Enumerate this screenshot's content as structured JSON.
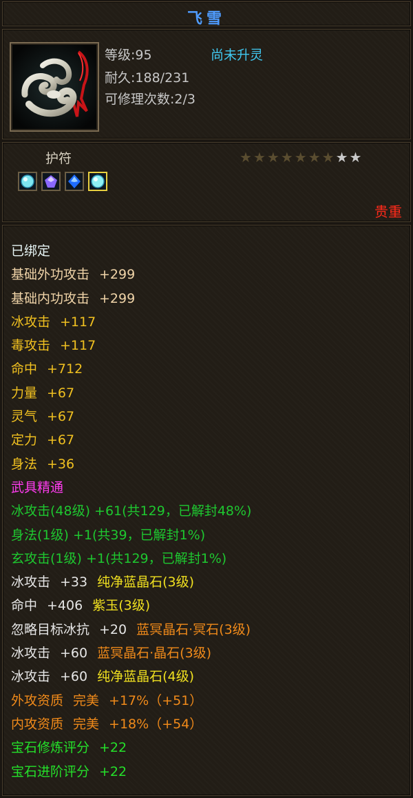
{
  "item": {
    "name": "飞雪",
    "level_text": "等级:95",
    "spirit_status": "尚未升灵",
    "durability_text": "耐久:188/231",
    "repair_text": "可修理次数:2/3",
    "type": "护符",
    "rarity": "贵重",
    "stars_total": 9,
    "stars_dim": 7,
    "gems": [
      "cyan-gem-icon",
      "purple-gem-icon",
      "blue-gem-icon",
      "cyan-gem-icon"
    ],
    "colors": {
      "title": "#4f9cff",
      "spirit": "#40c8f0",
      "rarity": "#ff2a1a"
    }
  },
  "stats": [
    {
      "a": "已绑定",
      "ca": "c-cyanw"
    },
    {
      "a": "基础外功攻击",
      "b": "+299",
      "ca": "c-peach",
      "cb": "c-peach"
    },
    {
      "a": "基础内功攻击",
      "b": "+299",
      "ca": "c-peach",
      "cb": "c-peach"
    },
    {
      "a": "冰攻击",
      "b": "+117",
      "ca": "c-yellow",
      "cb": "c-yellow"
    },
    {
      "a": "毒攻击",
      "b": "+117",
      "ca": "c-yellow",
      "cb": "c-yellow"
    },
    {
      "a": "命中",
      "b": "+712",
      "ca": "c-yellow",
      "cb": "c-yellow"
    },
    {
      "a": "力量",
      "b": "+67",
      "ca": "c-yellow",
      "cb": "c-yellow"
    },
    {
      "a": "灵气",
      "b": "+67",
      "ca": "c-yellow",
      "cb": "c-yellow"
    },
    {
      "a": "定力",
      "b": "+67",
      "ca": "c-yellow",
      "cb": "c-yellow"
    },
    {
      "a": "身法",
      "b": "+36",
      "ca": "c-yellow",
      "cb": "c-yellow"
    },
    {
      "a": "武具精通",
      "ca": "c-pink"
    },
    {
      "a": "冰攻击(48级) +61(共129，已解封48%)",
      "ca": "c-green"
    },
    {
      "a": "身法(1级) +1(共39，已解封1%)",
      "ca": "c-green"
    },
    {
      "a": "玄攻击(1级) +1(共129，已解封1%)",
      "ca": "c-green"
    },
    {
      "a": "冰攻击",
      "b": "+33",
      "c": "纯净蓝晶石(3级)",
      "ca": "c-white",
      "cb": "c-white",
      "cc": "c-gyellow"
    },
    {
      "a": "命中",
      "b": "+406",
      "c": "紫玉(3级)",
      "ca": "c-white",
      "cb": "c-white",
      "cc": "c-gyellow"
    },
    {
      "a": "忽略目标冰抗",
      "b": "+20",
      "c": "蓝冥晶石·冥石(3级)",
      "ca": "c-white",
      "cb": "c-white",
      "cc": "c-orange"
    },
    {
      "a": "冰攻击",
      "b": "+60",
      "c": "蓝冥晶石·晶石(3级)",
      "ca": "c-white",
      "cb": "c-white",
      "cc": "c-orange"
    },
    {
      "a": "冰攻击",
      "b": "+60",
      "c": "纯净蓝晶石(4级)",
      "ca": "c-white",
      "cb": "c-white",
      "cc": "c-gyellow"
    },
    {
      "a": "外攻资质",
      "b": "完美",
      "c": "+17%（+51）",
      "ca": "c-orange",
      "cb": "c-orange",
      "cc": "c-orange"
    },
    {
      "a": "内攻资质",
      "b": "完美",
      "c": "+18%（+54）",
      "ca": "c-orange",
      "cb": "c-orange",
      "cc": "c-orange"
    },
    {
      "a": "宝石修炼评分",
      "b": "+22",
      "ca": "c-bgreen",
      "cb": "c-bgreen"
    },
    {
      "a": "宝石进阶评分",
      "b": "+22",
      "ca": "c-bgreen",
      "cb": "c-bgreen"
    }
  ]
}
